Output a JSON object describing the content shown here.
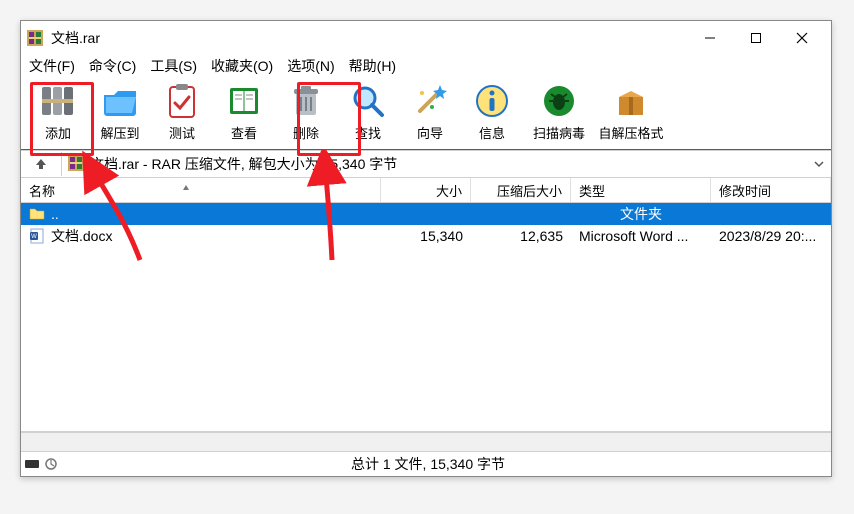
{
  "title": "文档.rar",
  "menu": {
    "file": "文件(F)",
    "command": "命令(C)",
    "tools": "工具(S)",
    "favorites": "收藏夹(O)",
    "options": "选项(N)",
    "help": "帮助(H)"
  },
  "toolbar": {
    "add": "添加",
    "extract": "解压到",
    "test": "测试",
    "view": "查看",
    "delete": "删除",
    "find": "查找",
    "wizard": "向导",
    "info": "信息",
    "scan": "扫描病毒",
    "sfx": "自解压格式"
  },
  "path": {
    "text": "文档.rar - RAR 压缩文件, 解包大小为 15,340 字节"
  },
  "columns": {
    "name": "名称",
    "size": "大小",
    "compressed": "压缩后大小",
    "type": "类型",
    "modified": "修改时间"
  },
  "rows": [
    {
      "name": "..",
      "size": "",
      "compressed": "",
      "type": "文件夹",
      "modified": "",
      "icon": "up",
      "selected": true
    },
    {
      "name": "文档.docx",
      "size": "15,340",
      "compressed": "12,635",
      "type": "Microsoft Word ...",
      "modified": "2023/8/29 20:...",
      "icon": "docx",
      "selected": false
    }
  ],
  "status": {
    "summary": "总计 1 文件, 15,340 字节"
  },
  "annotations": {
    "highlight_add": true,
    "highlight_delete": true,
    "arrows": 2
  }
}
